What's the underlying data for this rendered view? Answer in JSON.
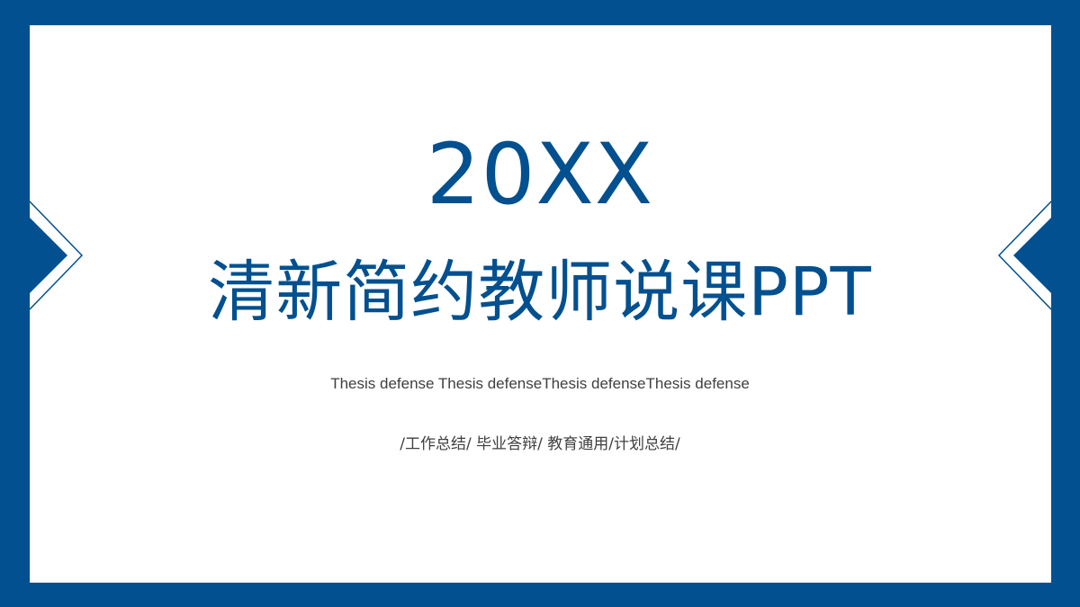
{
  "slide": {
    "year": "20XX",
    "title": "清新简约教师说课PPT",
    "subtitle": "Thesis defense Thesis defenseThesis defenseThesis defense",
    "tags": "/工作总结/ 毕业答辩/ 教育通用/计划总结/"
  },
  "colors": {
    "accent": "#02508f",
    "background": "#ffffff",
    "body_text": "#404040"
  },
  "decorations": {
    "left": "arrow-right-icon",
    "right": "arrow-left-icon"
  }
}
